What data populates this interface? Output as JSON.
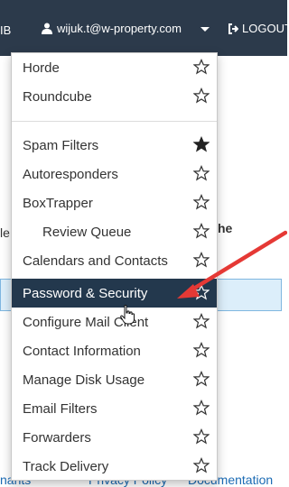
{
  "topbar": {
    "truncated_left": "IB",
    "user_email": "wijuk.t@w-property.com",
    "logout_label": "LOGOUT"
  },
  "background": {
    "fragment_left": "le",
    "fragment_right": "he",
    "footer_left": "nants",
    "footer_middle": "Privacy Policy",
    "footer_right": "Documentation"
  },
  "menu": {
    "items": [
      {
        "label": "Horde",
        "starred": false
      },
      {
        "label": "Roundcube",
        "starred": false
      },
      {
        "label": "Spam Filters",
        "starred": true
      },
      {
        "label": "Autoresponders",
        "starred": false
      },
      {
        "label": "BoxTrapper",
        "starred": false
      },
      {
        "label": "Review Queue",
        "starred": false
      },
      {
        "label": "Calendars and Contacts",
        "starred": false
      },
      {
        "label": "Password & Security",
        "starred": false
      },
      {
        "label": "Configure Mail Client",
        "starred": false
      },
      {
        "label": "Contact Information",
        "starred": false
      },
      {
        "label": "Manage Disk Usage",
        "starred": false
      },
      {
        "label": "Email Filters",
        "starred": false
      },
      {
        "label": "Forwarders",
        "starred": false
      },
      {
        "label": "Track Delivery",
        "starred": false
      }
    ]
  },
  "colors": {
    "navbar": "#2c3a4b",
    "active_item": "#23384d",
    "annotation_arrow": "#e53935"
  }
}
